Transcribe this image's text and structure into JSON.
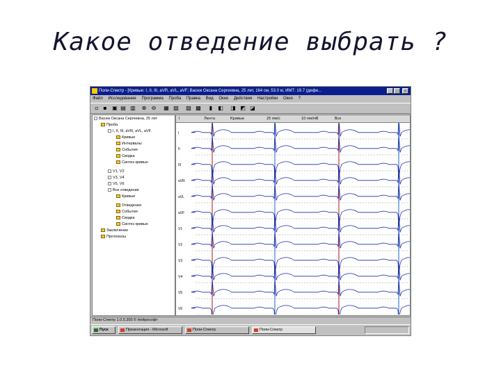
{
  "slide": {
    "title": "Какое отведение выбрать ?"
  },
  "window": {
    "title": "Поли-Спектр - [Кривые: I, II, III, aVR, aVL, aVF; Васюк Оксана Сергеевна, 25 лет, 164 см, 53.0 кг, ИМТ: 19.7 (дефи...",
    "min_glyph": "_",
    "max_glyph": "□",
    "close_glyph": "×"
  },
  "menu": [
    "Файл",
    "Исследование",
    "Программа",
    "Проба",
    "Правка",
    "Вид",
    "Окно",
    "Действия",
    "Настройки",
    "Окно",
    "?"
  ],
  "tree": {
    "items": [
      {
        "label": "Васюк Оксана Сергеевна, 25 лет",
        "indent": 0
      },
      {
        "label": "Проба",
        "indent": 1
      },
      {
        "label": "I, II, III, aVR, aVL, aVF",
        "indent": 2
      },
      {
        "label": "Кривые",
        "indent": 3
      },
      {
        "label": "Интервалы",
        "indent": 3
      },
      {
        "label": "События",
        "indent": 3
      },
      {
        "label": "Сводка",
        "indent": 3
      },
      {
        "label": "Синтез кривых",
        "indent": 3
      },
      {
        "label": "V1, V2",
        "indent": 2
      },
      {
        "label": "V3, V4",
        "indent": 2
      },
      {
        "label": "V5, V6",
        "indent": 2
      },
      {
        "label": "Все отведения",
        "indent": 2
      },
      {
        "label": "Кривые",
        "indent": 3
      },
      {
        "label": "Отведения",
        "indent": 3
      },
      {
        "label": "События",
        "indent": 3
      },
      {
        "label": "Сводка",
        "indent": 3
      },
      {
        "label": "Синтез кривых",
        "indent": 3
      },
      {
        "label": "Заключение",
        "indent": 1
      },
      {
        "label": "Протоколы",
        "indent": 1
      }
    ]
  },
  "ecg": {
    "leads": [
      "I",
      "II",
      "III",
      "aVR",
      "aVL",
      "aVF",
      "V1",
      "V2",
      "V3",
      "V4",
      "V5",
      "V6"
    ],
    "header_fields": [
      "I",
      "Лента",
      "Кривые",
      "25 мм/с",
      "10 мм/мВ",
      "Все"
    ],
    "colors": {
      "trace": "#1a2ca8",
      "grid": "#9090a0",
      "marker": "#b01010",
      "marker2": "#2060c0"
    }
  },
  "status": {
    "text": "Поли-Спектр 1.0.5.200 © Нейрософт"
  },
  "taskbar": {
    "start": "Пуск",
    "tasks": [
      "Презентация - Microsoft",
      "Поли-Спектр",
      "Поли-Спектр"
    ]
  }
}
